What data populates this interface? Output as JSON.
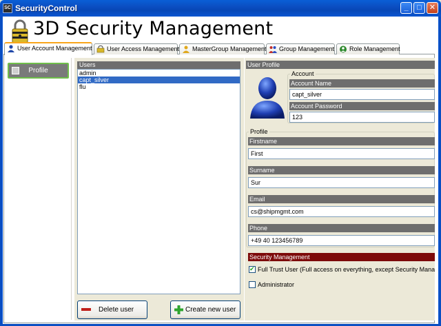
{
  "window": {
    "title": "SecurityControl",
    "app_icon_text": "SC",
    "controls": {
      "minimize": "_",
      "maximize": "□",
      "close": "✕"
    }
  },
  "header": {
    "title": "3D Security Management"
  },
  "tabs": [
    {
      "label": "User Account Management",
      "icon": "user-icon",
      "active": true
    },
    {
      "label": "User Access Management",
      "icon": "access-icon"
    },
    {
      "label": "MasterGroup Management",
      "icon": "mastergroup-icon"
    },
    {
      "label": "Group Management",
      "icon": "group-icon"
    },
    {
      "label": "Role Management",
      "icon": "role-icon"
    }
  ],
  "sidebar": {
    "profile_button": "Profile"
  },
  "users": {
    "header": "Users",
    "items": [
      "admin",
      "capt_silver",
      "flu"
    ],
    "selected_index": 1,
    "delete_button": "Delete user",
    "create_button": "Create new user"
  },
  "user_profile": {
    "header": "User Profile",
    "account": {
      "legend": "Account",
      "name_label": "Account Name",
      "name_value": "capt_silver",
      "password_label": "Account Password",
      "password_value": "123"
    },
    "profile": {
      "legend": "Profile",
      "firstname_label": "Firstname",
      "firstname_value": "First",
      "surname_label": "Surname",
      "surname_value": "Sur",
      "email_label": "Email",
      "email_value": "cs@shipmgmt.com",
      "phone_label": "Phone",
      "phone_value": "+49 40 123456789"
    },
    "security": {
      "header": "Security Management",
      "full_trust_label": "Full Trust User (Full access on everything, except Security Manage",
      "full_trust_checked": true,
      "administrator_label": "Administrator",
      "administrator_checked": false
    }
  },
  "colors": {
    "titlebar": "#0a55d0",
    "section_header": "#6e6e6e",
    "security_header": "#7d0a0a",
    "selection": "#316ac5",
    "active_tab_accent": "#f9a51a",
    "profile_button_border": "#6fbf4a"
  }
}
